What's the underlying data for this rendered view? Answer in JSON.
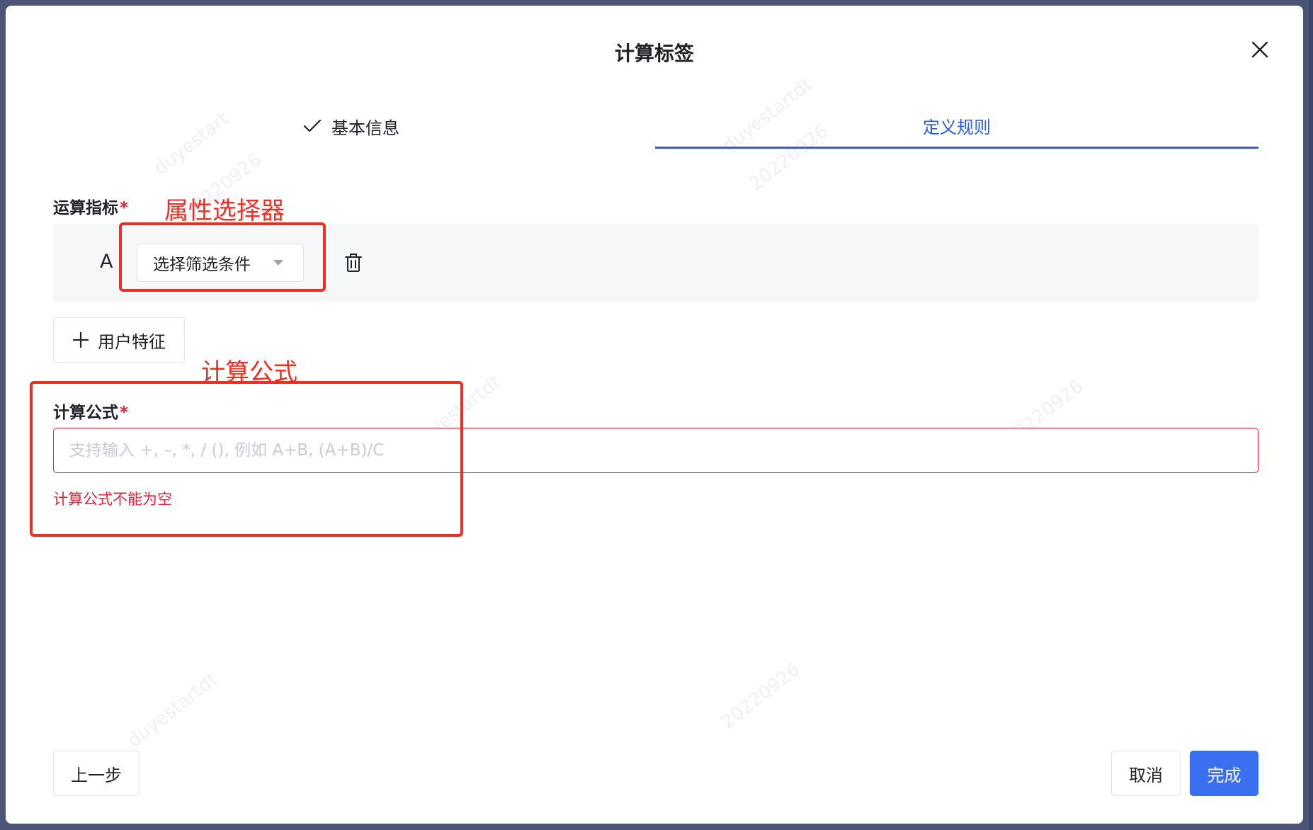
{
  "modal": {
    "title": "计算标签"
  },
  "steps": [
    {
      "label": "基本信息",
      "status": "done"
    },
    {
      "label": "定义规则",
      "status": "active"
    }
  ],
  "metric": {
    "label": "运算指标",
    "required_mark": "*",
    "rows": [
      {
        "letter": "A",
        "select_placeholder": "选择筛选条件"
      }
    ],
    "add_label": "用户特征"
  },
  "formula": {
    "label": "计算公式",
    "required_mark": "*",
    "placeholder": "支持输入 +, –, *, / (), 例如 A+B, (A+B)/C",
    "value": "",
    "error": "计算公式不能为空"
  },
  "annotations": {
    "selector_label": "属性选择器",
    "formula_label": "计算公式"
  },
  "footer": {
    "prev_label": "上一步",
    "cancel_label": "取消",
    "finish_label": "完成"
  },
  "watermarks": [
    "duyestart",
    "20220926",
    "duyestartdt",
    "20220926",
    "duyestartdt",
    "20220926",
    "duyestartdt",
    "20220926"
  ],
  "colors": {
    "primary": "#3a6ff2",
    "active_tab": "#2f5be7",
    "error": "#e3253c",
    "annotation": "#ee2e22",
    "backdrop": "#4b5578"
  }
}
